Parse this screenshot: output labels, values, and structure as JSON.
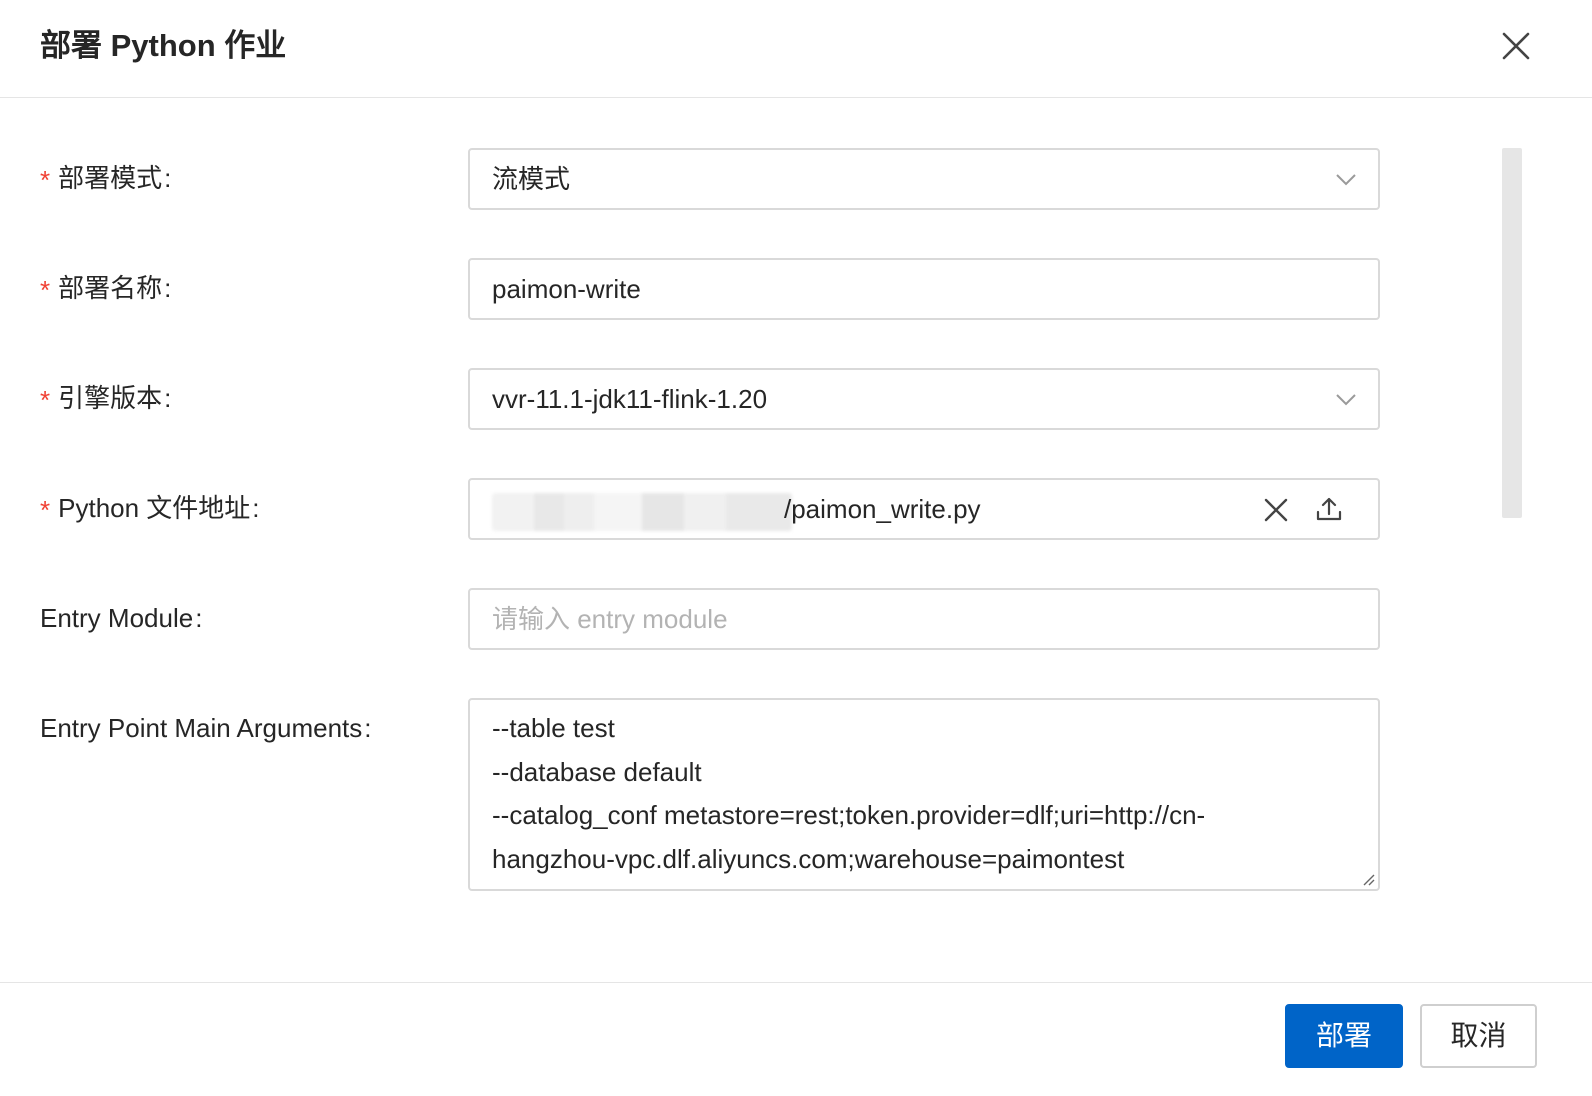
{
  "dialog": {
    "title": "部署 Python 作业",
    "close_icon": "close-icon"
  },
  "form": {
    "required_mark": "*",
    "colon": ":",
    "deploy_mode": {
      "label": "部署模式",
      "value": "流模式",
      "required": true
    },
    "deploy_name": {
      "label": "部署名称",
      "value": "paimon-write",
      "required": true
    },
    "engine_version": {
      "label": "引擎版本",
      "value": "vvr-11.1-jdk11-flink-1.20",
      "required": true
    },
    "python_file": {
      "label": "Python 文件地址",
      "value": "/paimon_write.py",
      "required": true
    },
    "entry_module": {
      "label": "Entry Module",
      "value": "",
      "placeholder": "请输入 entry module",
      "required": false
    },
    "entry_args": {
      "label": "Entry Point Main Arguments",
      "lines": [
        "--table test",
        "--database default",
        "--catalog_conf metastore=rest;token.provider=dlf;uri=http://cn-",
        "hangzhou-vpc.dlf.aliyuncs.com;warehouse=paimontest"
      ]
    }
  },
  "footer": {
    "deploy_label": "部署",
    "cancel_label": "取消"
  },
  "colors": {
    "primary": "#0064c8",
    "required": "#f04134",
    "border": "#d9d9d9",
    "placeholder": "#b3b3b3"
  }
}
